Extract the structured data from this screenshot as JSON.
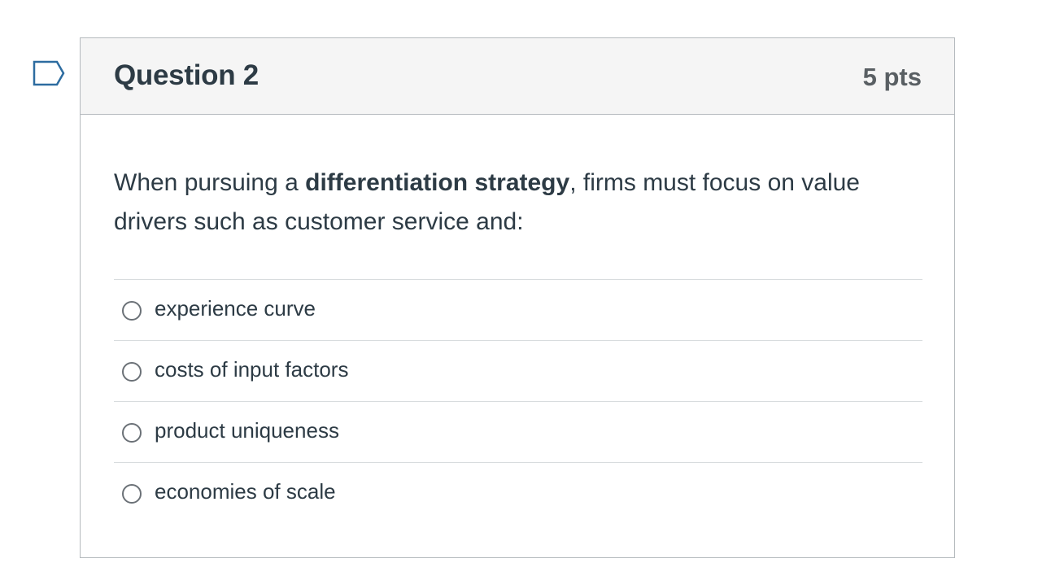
{
  "flag": {
    "icon": "flag-question-icon",
    "color": "#2d6ca0"
  },
  "question": {
    "title": "Question 2",
    "points": "5 pts",
    "text_before": "When pursuing a ",
    "text_bold": "differentiation strategy",
    "text_after": ", firms must focus on value drivers such as customer service and:"
  },
  "answers": [
    {
      "label": "experience curve",
      "selected": false
    },
    {
      "label": "costs of input factors",
      "selected": false
    },
    {
      "label": "product uniqueness",
      "selected": false
    },
    {
      "label": "economies of scale",
      "selected": false
    }
  ]
}
